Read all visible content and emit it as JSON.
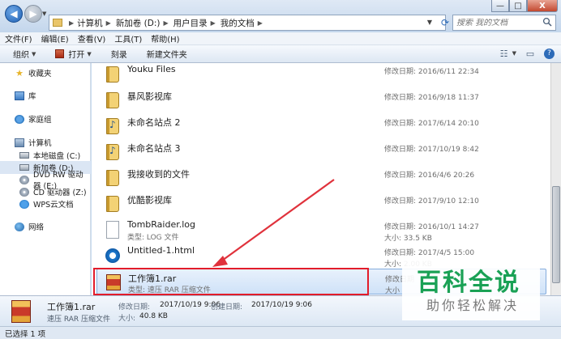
{
  "window": {
    "minimize": "—",
    "maximize": "□",
    "close": "X"
  },
  "address": {
    "segments": [
      "计算机",
      "新加卷 (D:)",
      "用户目录",
      "我的文档"
    ],
    "search_placeholder": "搜索 我的文档"
  },
  "menu": [
    "文件(F)",
    "编辑(E)",
    "查看(V)",
    "工具(T)",
    "帮助(H)"
  ],
  "toolbar": {
    "organize": "组织",
    "open": "打开",
    "burn": "刻录",
    "new_folder": "新建文件夹"
  },
  "nav": {
    "favorites": "收藏夹",
    "libraries": "库",
    "homegroup": "家庭组",
    "computer": "计算机",
    "local_c": "本地磁盘 (C:)",
    "new_d": "新加卷 (D:)",
    "dvd_e": "DVD RW 驱动器 (E:)",
    "cd_z": "CD 驱动器 (Z:)",
    "wps": "WPS云文档",
    "network": "网络"
  },
  "files": [
    {
      "name": "Youku Files",
      "type": "",
      "date": "修改日期: 2016/6/11 22:34",
      "size": "",
      "icon": "folder-icon"
    },
    {
      "name": "暴风影视库",
      "type": "",
      "date": "修改日期: 2016/9/18 11:37",
      "size": "",
      "icon": "folder-icon"
    },
    {
      "name": "未命名站点 2",
      "type": "",
      "date": "修改日期: 2017/6/14 20:10",
      "size": "",
      "icon": "music-folder-icon"
    },
    {
      "name": "未命名站点 3",
      "type": "",
      "date": "修改日期: 2017/10/19 8:42",
      "size": "",
      "icon": "music-folder-icon"
    },
    {
      "name": "我接收到的文件",
      "type": "",
      "date": "修改日期: 2016/4/6 20:26",
      "size": "",
      "icon": "folder-icon"
    },
    {
      "name": "优酷影视库",
      "type": "",
      "date": "修改日期: 2017/9/10 12:10",
      "size": "",
      "icon": "folder-icon"
    },
    {
      "name": "TombRaider.log",
      "type": "类型: LOG 文件",
      "date": "修改日期: 2016/10/1 14:27",
      "size": "大小: 33.5 KB",
      "icon": "document-icon"
    },
    {
      "name": "Untitled-1.html",
      "type": "",
      "date": "修改日期: 2017/4/5 15:00",
      "size": "大小: 2.00 KB",
      "icon": "html-file-icon"
    },
    {
      "name": "工作簿1.rar",
      "type": "类型: 速压 RAR 压缩文件",
      "date": "修改日期",
      "size": "大小",
      "icon": "rar-archive-icon"
    }
  ],
  "details": {
    "name": "工作簿1.rar",
    "type": "速压 RAR 压缩文件",
    "modified_label": "修改日期:",
    "modified": "2017/10/19 9:06",
    "created_label": "创建日期:",
    "created": "2017/10/19 9:06",
    "size_label": "大小:",
    "size": "40.8 KB"
  },
  "status": "已选择 1 项",
  "watermark": {
    "logo": "百科全说",
    "subtitle": "助你轻松解决"
  },
  "colors": {
    "highlight": "#e21c2a",
    "selection": "#cfe2f8",
    "watermark": "#1aa155"
  }
}
